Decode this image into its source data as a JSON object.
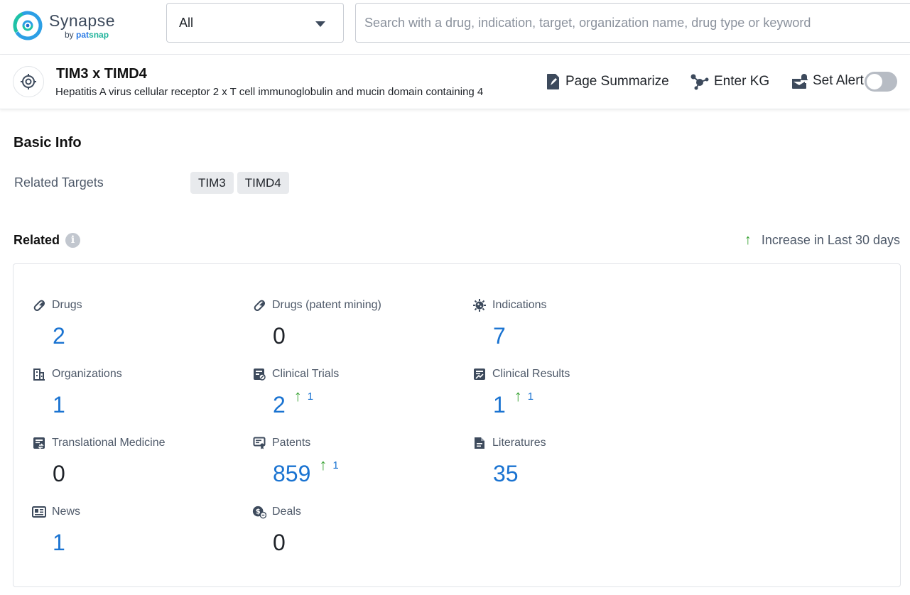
{
  "header": {
    "logo_name": "Synapse",
    "logo_by": "by",
    "logo_brand_a": "pat",
    "logo_brand_b": "snap",
    "select_value": "All",
    "search_placeholder": "Search with a drug, indication, target, organization name, drug type or keyword"
  },
  "titlebar": {
    "title": "TIM3 x TIMD4",
    "subtitle": "Hepatitis A virus cellular receptor 2 x T cell immunoglobulin and mucin domain containing 4",
    "actions": {
      "summarize": "Page Summarize",
      "kg": "Enter KG",
      "alert": "Set Alert"
    },
    "alert_enabled": false
  },
  "basic_info": {
    "title": "Basic Info",
    "related_targets_label": "Related Targets",
    "targets": [
      "TIM3",
      "TIMD4"
    ]
  },
  "related": {
    "title": "Related",
    "info_glyph": "i",
    "legend_arrow": "↑",
    "legend_text": "Increase in Last 30 days",
    "items": [
      {
        "label": "Drugs",
        "value": "2",
        "link": true,
        "icon": "pill-icon"
      },
      {
        "label": "Drugs (patent mining)",
        "value": "0",
        "link": false,
        "icon": "pill-icon"
      },
      {
        "label": "Indications",
        "value": "7",
        "link": true,
        "icon": "virus-icon"
      },
      {
        "label": "Organizations",
        "value": "1",
        "link": true,
        "icon": "building-icon"
      },
      {
        "label": "Clinical Trials",
        "value": "2",
        "link": true,
        "icon": "clinical-trials-icon",
        "increase_arrow": "↑",
        "increase": "1"
      },
      {
        "label": "Clinical Results",
        "value": "1",
        "link": true,
        "icon": "clinical-results-icon",
        "increase_arrow": "↑",
        "increase": "1"
      },
      {
        "label": "Translational Medicine",
        "value": "0",
        "link": false,
        "icon": "translational-medicine-icon"
      },
      {
        "label": "Patents",
        "value": "859",
        "link": true,
        "icon": "patent-icon",
        "increase_arrow": "↑",
        "increase": "1"
      },
      {
        "label": "Literatures",
        "value": "35",
        "link": true,
        "icon": "document-icon"
      },
      {
        "label": "News",
        "value": "1",
        "link": true,
        "icon": "newspaper-icon"
      },
      {
        "label": "Deals",
        "value": "0",
        "link": false,
        "icon": "deals-icon"
      }
    ]
  },
  "colors": {
    "link_blue": "#1a73d1",
    "increase_green": "#3aa335",
    "text_secondary": "#4e5969"
  }
}
